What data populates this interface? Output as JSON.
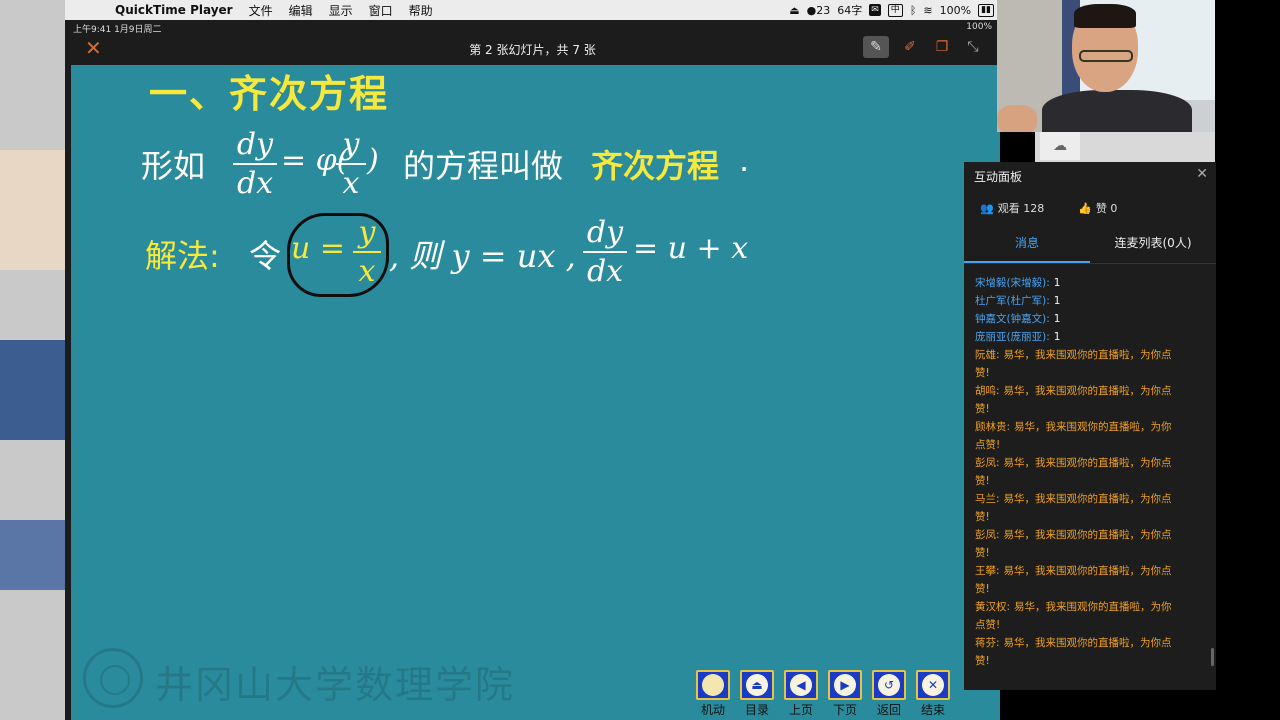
{
  "menubar": {
    "app_name": "QuickTime Player",
    "menus": [
      "文件",
      "编辑",
      "显示",
      "窗口",
      "帮助"
    ],
    "status": {
      "badge_count": "23",
      "ime": "64字",
      "ime_mode": "中",
      "battery": "100%"
    }
  },
  "ipad_status": {
    "left": "上午9:41  1月9日周二",
    "right": "100%"
  },
  "slide_toolbar": {
    "slide_count": "第 2 张幻灯片，共 7 张"
  },
  "slide": {
    "title": "一、齐次方程",
    "line1": {
      "prefix": "形如",
      "frac1_num": "dy",
      "frac1_den": "dx",
      "eq": "= φ(",
      "frac2_num": "y",
      "frac2_den": "x",
      "close": ")",
      "middle": "的方程叫做",
      "highlight": "齐次方程",
      "dot": "."
    },
    "line2": {
      "label": "解法:",
      "let": "令",
      "u": "u =",
      "frac_num": "y",
      "frac_den": "x",
      "then": ",  则 y = ux ,",
      "frac3_num": "dy",
      "frac3_den": "dx",
      "tail": "= u + x"
    },
    "watermark": "井冈山大学数理学院"
  },
  "slide_nav": [
    {
      "label": "机动",
      "icon": "circle"
    },
    {
      "label": "目录",
      "icon": "eject"
    },
    {
      "label": "上页",
      "icon": "◀"
    },
    {
      "label": "下页",
      "icon": "▶"
    },
    {
      "label": "返回",
      "icon": "↺"
    },
    {
      "label": "结束",
      "icon": "✕"
    }
  ],
  "panel": {
    "title": "互动面板",
    "viewers": "观看 128",
    "likes": "赞 0",
    "tabs": [
      "消息",
      "连麦列表(0人)"
    ],
    "messages": [
      {
        "name": "宋增毅(宋增毅):",
        "text": "1",
        "style": "blue"
      },
      {
        "name": "杜广军(杜广军):",
        "text": "1",
        "style": "blue"
      },
      {
        "name": "钟嘉文(钟嘉文):",
        "text": "1",
        "style": "blue"
      },
      {
        "name": "庞丽亚(庞丽亚):",
        "text": "1",
        "style": "blue"
      },
      {
        "name": "阮雄:",
        "text": "易华，我来围观你的直播啦，为你点赞!",
        "style": "orange"
      },
      {
        "name": "胡鸣:",
        "text": "易华，我来围观你的直播啦，为你点赞!",
        "style": "orange"
      },
      {
        "name": "顾林贵:",
        "text": "易华，我来围观你的直播啦，为你点赞!",
        "style": "orange"
      },
      {
        "name": "彭凤:",
        "text": "易华，我来围观你的直播啦，为你点赞!",
        "style": "orange"
      },
      {
        "name": "马兰:",
        "text": "易华，我来围观你的直播啦，为你点赞!",
        "style": "orange"
      },
      {
        "name": "彭凤:",
        "text": "易华，我来围观你的直播啦，为你点赞!",
        "style": "orange"
      },
      {
        "name": "王攀:",
        "text": "易华，我来围观你的直播啦，为你点赞!",
        "style": "orange"
      },
      {
        "name": "黄汉权:",
        "text": "易华，我来围观你的直播啦，为你点赞!",
        "style": "orange"
      },
      {
        "name": "蒋芬:",
        "text": "易华，我来围观你的直播啦，为你点赞!",
        "style": "orange"
      }
    ]
  },
  "colors": {
    "slide_bg": "#2a8b9c",
    "title_yellow": "#f6e83c",
    "tab_blue": "#4aa3f0",
    "msg_orange": "#f0a020"
  }
}
